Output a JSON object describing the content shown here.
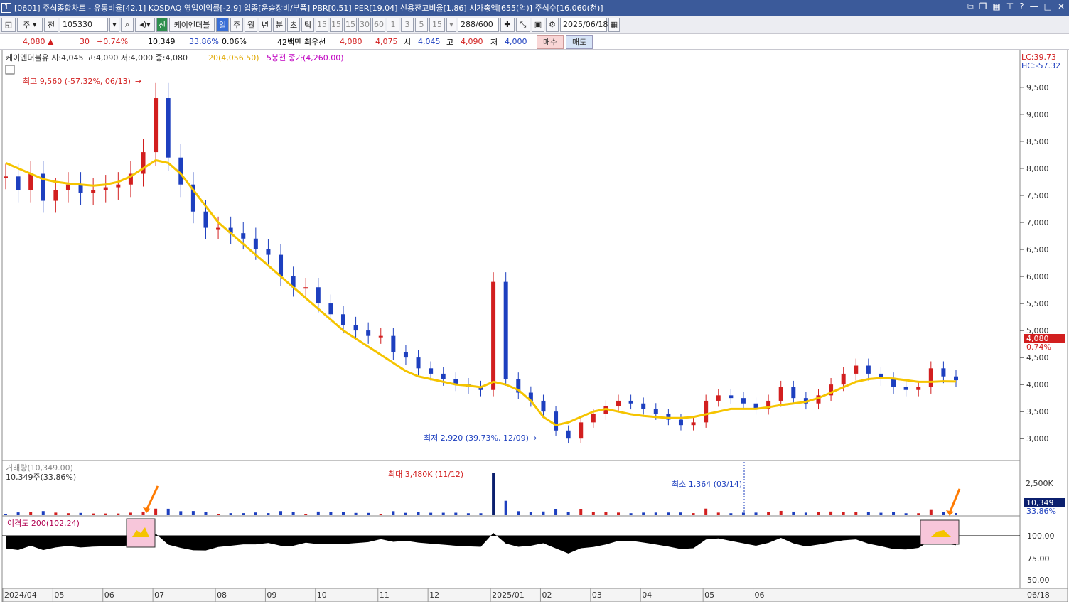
{
  "window": {
    "title": "[0601] 주식종합차트 - 유통비율[42.1] KOSDAQ 영업이익률[-2.9] 업종[운송장비/부품] PBR[0.51] PER[19.04] 신용잔고비율[1.86] 시가총액[655(억)] 주식수[16,060(천)]",
    "number": "1"
  },
  "toolbar": {
    "period_select": "주",
    "prev_label": "전",
    "code": "105330",
    "credit_badge": "신",
    "stock_name": "케이엔더블",
    "tabs": [
      "일",
      "주",
      "월",
      "년",
      "분",
      "초",
      "틱"
    ],
    "active_tab": "일",
    "minute_buttons": [
      "15",
      "15",
      "15",
      "30",
      "60",
      "1",
      "3",
      "5",
      "15"
    ],
    "count": "288",
    "count_total": "/600",
    "date": "2025/06/18"
  },
  "info": {
    "price": "4,080",
    "change": "30",
    "change_pct": "+0.74%",
    "volume": "10,349",
    "turnover_pct": "33.86%",
    "pct2": "0.06%",
    "amount": "42백만",
    "best_label": "최우선",
    "best_value": "4,080",
    "best_value2": "4,075",
    "open_label": "시",
    "open_value": "4,045",
    "high_label": "고",
    "high_value": "4,090",
    "low_label": "저",
    "low_value": "4,000",
    "buy_label": "매수",
    "sell_label": "매도"
  },
  "price_panel": {
    "legend": "케이엔더블유 시:4,045 고:4,090 저:4,000 종:4,080",
    "ma_legend": "20(4,056.50)",
    "prev_legend": "5봉전 종가(4,260.00)",
    "lc_label": "LC:39.73",
    "hc_label": "HC:-57.32",
    "high_annotation": "최고 9,560 (-57.32%, 06/13)",
    "low_annotation": "최저 2,920 (39.73%, 12/09)",
    "current_price_tag": "4,080",
    "current_pct_tag": "0.74%",
    "y_ticks": [
      "9,500",
      "9,000",
      "8,500",
      "8,000",
      "7,500",
      "7,000",
      "6,500",
      "6,000",
      "5,500",
      "5,000",
      "4,500",
      "4,000",
      "3,500",
      "3,000"
    ]
  },
  "volume_panel": {
    "legend": "거래량(10,349.00)",
    "sub_legend": "10,349주(33.86%)",
    "max_annotation": "최대 3,480K (11/12)",
    "min_annotation": "최소 1,364 (03/14)",
    "y_tick": "2,500K",
    "current_tag": "10,349",
    "current_pct_tag": "33.86%"
  },
  "disparity_panel": {
    "legend": "이격도 200(102.24)",
    "y_ticks": [
      "100.00",
      "75.00",
      "50.00"
    ]
  },
  "x_axis": {
    "labels": [
      "2024/04",
      "05",
      "06",
      "07",
      "08",
      "09",
      "10",
      "11",
      "12",
      "2025/01",
      "02",
      "03",
      "04",
      "05",
      "06"
    ],
    "end_label": "06/18"
  },
  "colors": {
    "up": "#d21f1f",
    "down": "#1d3fbf",
    "ma": "#f5c400",
    "annotation_arrow": "#ff7a00",
    "highlight_box": "#f7c6da"
  },
  "chart_data": {
    "type": "candlestick",
    "ma_period": 20,
    "price_range": [
      2700,
      9800
    ],
    "weeks": [
      "2024/04",
      "",
      "",
      "",
      "05",
      "",
      "",
      "",
      "06",
      "",
      "",
      "",
      "07",
      "",
      "",
      "",
      "",
      "08",
      "",
      "",
      "",
      "09",
      "",
      "",
      "",
      "10",
      "",
      "",
      "",
      "",
      "11",
      "",
      "",
      "",
      "12",
      "",
      "",
      "",
      "",
      "2025/01",
      "",
      "",
      "",
      "02",
      "",
      "",
      "",
      "03",
      "",
      "",
      "",
      "04",
      "",
      "",
      "",
      "",
      "05",
      "",
      "",
      "",
      "06",
      "",
      ""
    ],
    "close": [
      7850,
      7600,
      7900,
      7400,
      7600,
      7700,
      7550,
      7600,
      7650,
      7700,
      7900,
      8300,
      9300,
      8200,
      7700,
      7200,
      6900,
      6900,
      6800,
      6700,
      6500,
      6400,
      6000,
      5800,
      5800,
      5500,
      5300,
      5100,
      5000,
      4900,
      4900,
      4600,
      4500,
      4300,
      4200,
      4100,
      4000,
      3950,
      3900,
      5900,
      4100,
      3850,
      3700,
      3500,
      3150,
      3000,
      3300,
      3450,
      3600,
      3700,
      3650,
      3550,
      3450,
      3350,
      3250,
      3300,
      3700,
      3800,
      3750,
      3650,
      3550,
      3700,
      3950,
      3750,
      3650,
      3800,
      4000,
      4200,
      4350,
      4200,
      4100,
      3950,
      3900,
      3950,
      4300,
      4150,
      4080
    ],
    "ma20": [
      8100,
      8000,
      7900,
      7800,
      7750,
      7720,
      7700,
      7680,
      7700,
      7750,
      7850,
      8000,
      8150,
      8100,
      7900,
      7600,
      7300,
      7000,
      6800,
      6600,
      6400,
      6200,
      6000,
      5800,
      5600,
      5400,
      5200,
      5000,
      4850,
      4700,
      4550,
      4400,
      4250,
      4150,
      4100,
      4050,
      4000,
      3980,
      3950,
      4050,
      4000,
      3900,
      3700,
      3400,
      3250,
      3300,
      3400,
      3500,
      3550,
      3500,
      3450,
      3420,
      3400,
      3380,
      3380,
      3400,
      3450,
      3500,
      3550,
      3550,
      3550,
      3580,
      3620,
      3650,
      3680,
      3750,
      3850,
      3950,
      4050,
      4100,
      4120,
      4110,
      4080,
      4050,
      4050,
      4060,
      4056
    ],
    "volume_max_label": "3,480K",
    "disparity_current": 102.24
  }
}
